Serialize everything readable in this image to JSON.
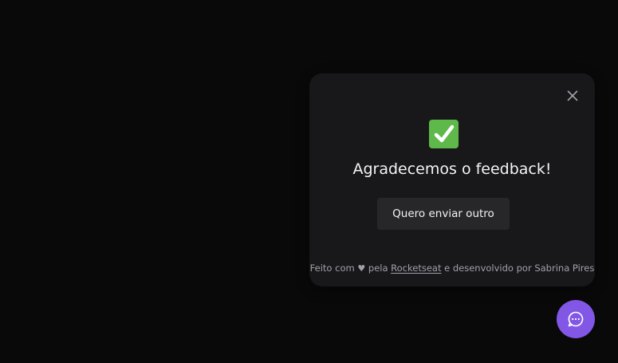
{
  "widget": {
    "title": "Agradecemos o feedback!",
    "again_button_label": "Quero enviar outro",
    "success_icon": "check-mark-icon",
    "close_icon": "close-icon",
    "footer": {
      "prefix": "Feito com",
      "heart": "♥",
      "by": "pela",
      "link_label": "Rocketseat",
      "suffix": "e desenvolvido por Sabrina Pires"
    }
  },
  "fab": {
    "icon": "chat-bubble-icon"
  },
  "colors": {
    "background": "#09090a",
    "surface": "#18181b",
    "button": "#27272a",
    "brand": "#8257e5",
    "success": "#5fb84a"
  }
}
